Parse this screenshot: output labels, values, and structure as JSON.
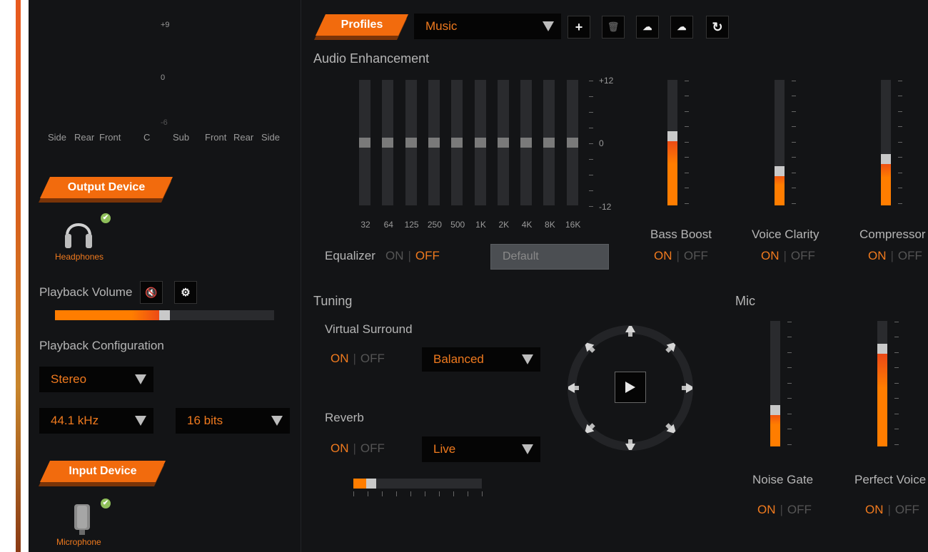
{
  "levels": {
    "top": "+9",
    "mid": "0",
    "bottom": "-6"
  },
  "channels": [
    "Side",
    "Rear",
    "Front",
    "C",
    "Sub",
    "Front",
    "Rear",
    "Side"
  ],
  "output_device": {
    "title": "Output Device",
    "device_label": "Headphones"
  },
  "playback": {
    "volume_label": "Playback Volume",
    "volume_level": 0.5,
    "config_label": "Playback Configuration",
    "config_value": "Stereo",
    "rate_value": "44.1 kHz",
    "bits_value": "16 bits"
  },
  "input_device": {
    "title": "Input Device",
    "device_label": "Microphone"
  },
  "profiles": {
    "label": "Profiles",
    "selected": "Music"
  },
  "enhancement": {
    "title": "Audio Enhancement",
    "eq_bands": [
      "32",
      "64",
      "125",
      "250",
      "500",
      "1K",
      "2K",
      "4K",
      "8K",
      "16K"
    ],
    "eq_scale": {
      "top": "+12",
      "mid": "0",
      "bottom": "-12"
    },
    "equalizer_label": "Equalizer",
    "equalizer_on": "ON",
    "equalizer_off": "OFF",
    "equalizer_preset": "Default",
    "bass_boost": {
      "label": "Bass Boost",
      "on": "ON",
      "off": "OFF",
      "level": 0.55
    },
    "voice_clarity": {
      "label": "Voice Clarity",
      "on": "ON",
      "off": "OFF",
      "level": 0.27
    },
    "compressor": {
      "label": "Compressor",
      "on": "ON",
      "off": "OFF",
      "level": 0.37
    }
  },
  "tuning": {
    "title": "Tuning",
    "surround_label": "Virtual Surround",
    "surround_on": "ON",
    "surround_off": "OFF",
    "surround_mode": "Balanced",
    "reverb_label": "Reverb",
    "reverb_on": "ON",
    "reverb_off": "OFF",
    "reverb_mode": "Live",
    "reverb_level": 0.14
  },
  "mic": {
    "title": "Mic",
    "noise_gate": {
      "label": "Noise Gate",
      "on": "ON",
      "off": "OFF",
      "level": 0.29
    },
    "perfect_voice": {
      "label": "Perfect Voice",
      "on": "ON",
      "off": "OFF",
      "level": 0.78
    }
  },
  "colors": {
    "accent": "#f26b0d",
    "background": "#131416"
  }
}
